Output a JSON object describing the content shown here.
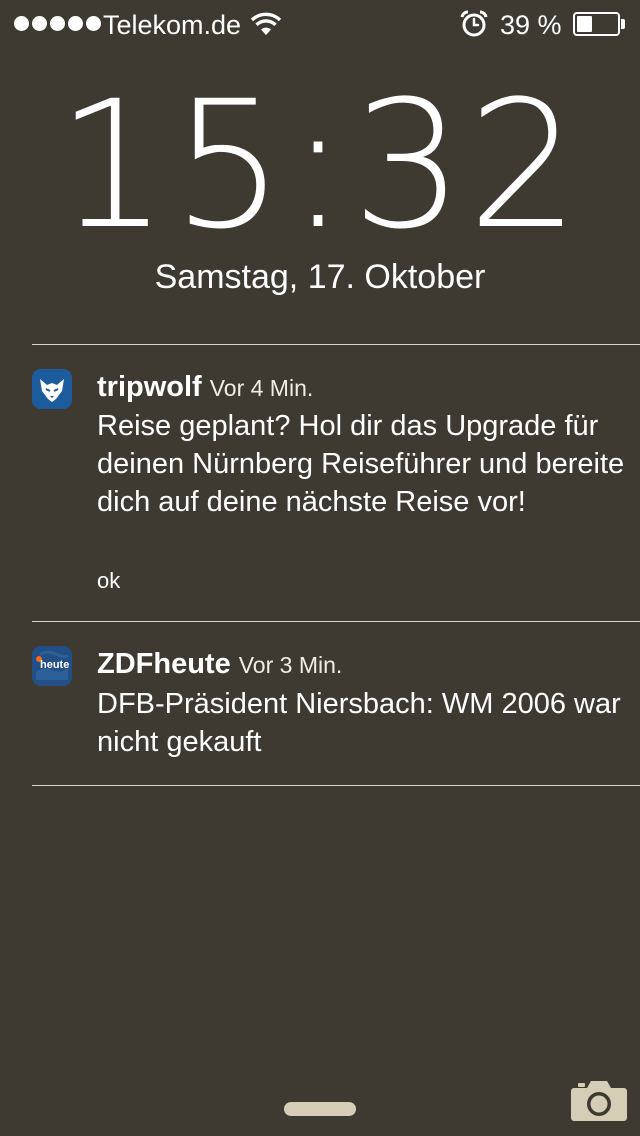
{
  "status_bar": {
    "carrier": "Telekom.de",
    "signal_bars": 5,
    "battery_percent_label": "39 %",
    "battery_level": 0.39,
    "icons": [
      "wifi-icon",
      "alarm-icon",
      "battery-icon"
    ]
  },
  "lockscreen": {
    "time": "15:32",
    "date": "Samstag, 17. Oktober"
  },
  "notifications": [
    {
      "app": "tripwolf",
      "time": "Vor 4 Min.",
      "body": "Reise geplant? Hol dir das Upgrade für deinen Nürnberg Reiseführer und bereite dich auf deine nächste Reise vor!",
      "action": "ok",
      "icon": "tripwolf-app-icon",
      "icon_color": "#1d5c9c"
    },
    {
      "app": "ZDFheute",
      "time": "Vor 3 Min.",
      "body": "DFB-Präsident Niersbach: WM 2006 war nicht gekauft",
      "icon": "zdfheute-app-icon",
      "icon_label": "heute",
      "icon_color": "#214f86",
      "icon_accent": "#f26a1b"
    }
  ],
  "colors": {
    "background": "#3e3a31",
    "divider": "#d8d4cb",
    "grabber": "#d6cdb6"
  }
}
